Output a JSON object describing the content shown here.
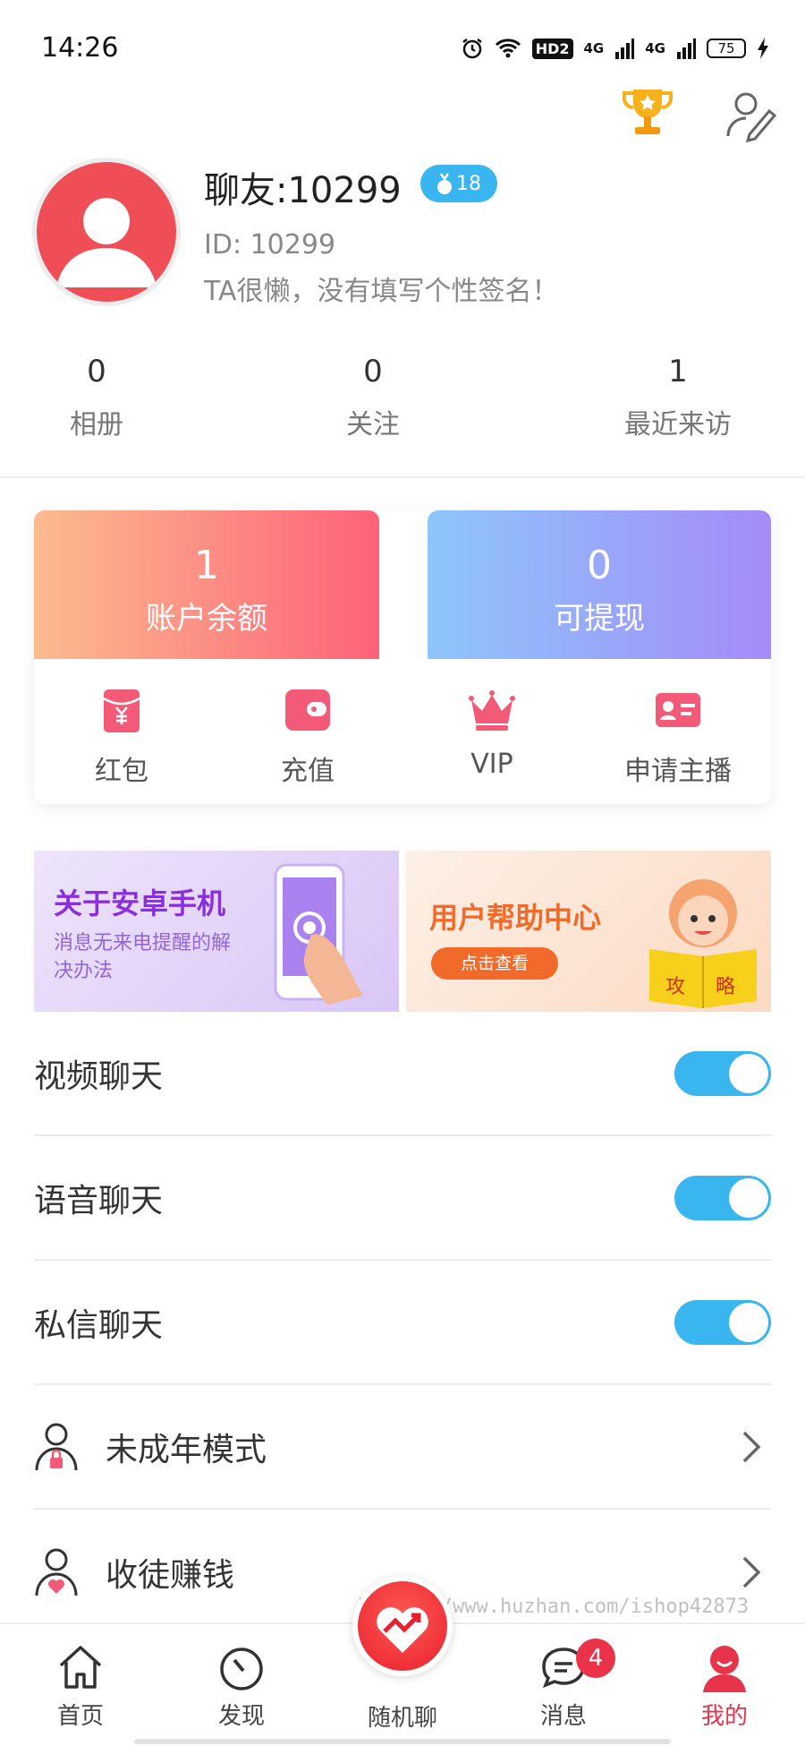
{
  "status_bar": {
    "time": "14:26",
    "hd_label": "HD2",
    "net_1": "4G",
    "net_2": "4G",
    "battery": "75"
  },
  "profile": {
    "nickname": "聊友:10299",
    "level": "18",
    "id_text": "ID: 10299",
    "signature": "TA很懒，没有填写个性签名！"
  },
  "stats": [
    {
      "value": "0",
      "label": "相册"
    },
    {
      "value": "0",
      "label": "关注"
    },
    {
      "value": "1",
      "label": "最近来访"
    }
  ],
  "wallet": {
    "balance_value": "1",
    "balance_label": "账户余额",
    "withdraw_value": "0",
    "withdraw_label": "可提现"
  },
  "actions": [
    {
      "label": "红包",
      "icon": "red-packet-icon"
    },
    {
      "label": "充值",
      "icon": "wallet-icon"
    },
    {
      "label": "VIP",
      "icon": "crown-icon"
    },
    {
      "label": "申请主播",
      "icon": "id-card-icon"
    }
  ],
  "banners": {
    "android": {
      "title": "关于安卓手机",
      "subtitle": "消息无来电提醒的解决办法"
    },
    "help": {
      "title": "用户帮助中心",
      "button": "点击查看",
      "book_left": "攻",
      "book_right": "略"
    }
  },
  "settings": {
    "video_chat": {
      "label": "视频聊天",
      "enabled": true
    },
    "voice_chat": {
      "label": "语音聊天",
      "enabled": true
    },
    "private_chat": {
      "label": "私信聊天",
      "enabled": true
    },
    "minor_mode": {
      "label": "未成年模式"
    },
    "recruit": {
      "label": "收徒赚钱"
    }
  },
  "watermark": "https://www.huzhan.com/ishop42873",
  "tabbar": {
    "items": [
      {
        "label": "首页",
        "icon": "home-icon"
      },
      {
        "label": "发现",
        "icon": "compass-icon"
      },
      {
        "label": "随机聊",
        "icon": "heart-random-icon"
      },
      {
        "label": "消息",
        "icon": "chat-icon",
        "badge": "4"
      },
      {
        "label": "我的",
        "icon": "profile-icon",
        "active": true
      }
    ]
  },
  "colors": {
    "accent": "#39b6f0",
    "active_tab": "#e8344a",
    "avatar_bg": "#f04e56"
  }
}
